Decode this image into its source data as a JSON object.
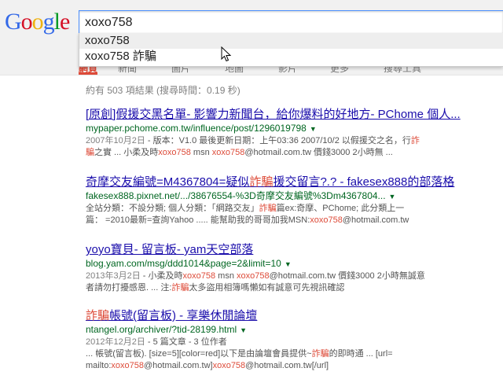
{
  "logo": {
    "letters": [
      "G",
      "o",
      "o",
      "g",
      "l",
      "e"
    ],
    "colors": [
      "#3369e8",
      "#d50f25",
      "#eeb211",
      "#3369e8",
      "#009925",
      "#d50f25"
    ]
  },
  "search": {
    "query": "xoxo758"
  },
  "suggestions": [
    {
      "text": "xoxo758"
    },
    {
      "text": "xoxo758 詐騙"
    }
  ],
  "tabs": [
    "網頁",
    "新聞",
    "圖片",
    "地圖",
    "影片",
    "更多",
    "搜尋工具"
  ],
  "stats": "約有 503 項結果 (搜尋時間：0.19 秒)",
  "results": [
    {
      "title_parts": [
        {
          "t": "[原創]假援交黑名單- 影響力新聞台，給你爆料的好地方- PChome 個人..."
        }
      ],
      "url": "mypaper.pchome.com.tw/influence/post/1296019798",
      "lines": [
        [
          {
            "t": "2007年10月2日",
            "c": "date"
          },
          {
            "t": " - 版本：V1.0 最後更新日期：上午03:36 2007/10/2 以假援交之名，行"
          },
          {
            "t": "詐",
            "c": "hl"
          }
        ],
        [
          {
            "t": "騙",
            "c": "hl"
          },
          {
            "t": "之實 ... 小柔及時"
          },
          {
            "t": "xoxo758",
            "c": "hl"
          },
          {
            "t": " msn "
          },
          {
            "t": "xoxo758",
            "c": "hl"
          },
          {
            "t": "@hotmail.com.tw 價錢3000 2小時無 ..."
          }
        ]
      ]
    },
    {
      "title_parts": [
        {
          "t": "奇摩交友編號=M4367804=疑似"
        },
        {
          "t": "詐騙",
          "c": "hl"
        },
        {
          "t": "援交留言?.? - fakesex888的部落格"
        }
      ],
      "url": "fakesex888.pixnet.net/.../38676554-%3D奇摩交友編號%3Dm4367804...",
      "lines": [
        [
          {
            "t": "全站分類：不設分類; 個人分類：「網路交友」"
          },
          {
            "t": "詐騙",
            "c": "hl"
          },
          {
            "t": "篇ex:奇摩、PChome; 此分類上一"
          }
        ],
        [
          {
            "t": "篇： =2010最新=查詢Yahoo ..... 能幫助我的哥哥加我MSN:"
          },
          {
            "t": "xoxo758",
            "c": "hl"
          },
          {
            "t": "@hotmail.com.tw"
          }
        ]
      ]
    },
    {
      "title_parts": [
        {
          "t": "yoyo寶貝- 留言板- yam天空部落"
        }
      ],
      "url": "blog.yam.com/msg/ddd1014&page=2&limit=10",
      "lines": [
        [
          {
            "t": "2013年3月2日",
            "c": "date"
          },
          {
            "t": " - 小柔及時"
          },
          {
            "t": "xoxo758",
            "c": "hl"
          },
          {
            "t": " msn "
          },
          {
            "t": "xoxo758",
            "c": "hl"
          },
          {
            "t": "@hotmail.com.tw 價錢3000 2小時無誠意"
          }
        ],
        [
          {
            "t": "者請勿打擾感恩. ... 注:"
          },
          {
            "t": "詐騙",
            "c": "hl"
          },
          {
            "t": "太多盜用相簿嗎懶如有誠意可先視訊確認"
          }
        ]
      ]
    },
    {
      "title_parts": [
        {
          "t": "詐騙",
          "c": "hl"
        },
        {
          "t": "帳號(留言板) - 享樂休閒論壇"
        }
      ],
      "url": "ntangel.org/archiver/?tid-28199.html",
      "lines": [
        [
          {
            "t": "2012年12月2日",
            "c": "date"
          },
          {
            "t": " - 5 篇文章 - 3 位作者"
          }
        ],
        [
          {
            "t": "... 帳號(留言板). [size=5][color=red]以下是由論壇會員提供~"
          },
          {
            "t": "詐騙",
            "c": "hl"
          },
          {
            "t": "的即時通 ... [url="
          }
        ],
        [
          {
            "t": "mailto:"
          },
          {
            "t": "xoxo758",
            "c": "hl"
          },
          {
            "t": "@hotmail.com.tw]"
          },
          {
            "t": "xoxo758",
            "c": "hl"
          },
          {
            "t": "@hotmail.com.tw[/url]"
          }
        ]
      ]
    }
  ]
}
